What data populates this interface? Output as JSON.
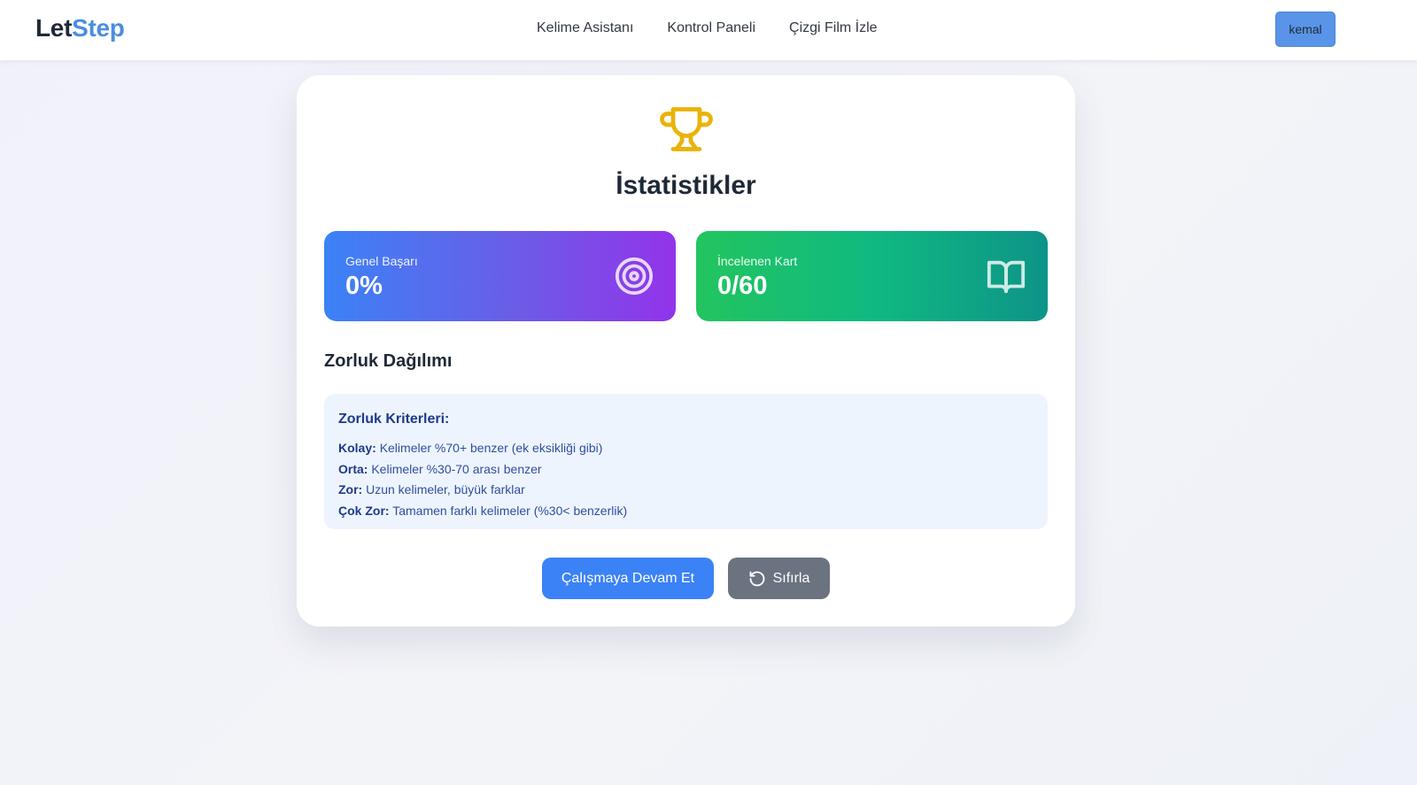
{
  "nav": {
    "logo_part1": "Let",
    "logo_part2": "Step",
    "links": [
      "Kelime Asistanı",
      "Kontrol Paneli",
      "Çizgi Film İzle"
    ],
    "user": "kemal"
  },
  "stats": {
    "title": "İstatistikler",
    "cards": [
      {
        "label": "Genel Başarı",
        "value": "0%",
        "icon": "target-icon"
      },
      {
        "label": "İncelenen Kart",
        "value": "0/60",
        "icon": "open-book-icon"
      }
    ]
  },
  "difficulty": {
    "section_title": "Zorluk Dağılımı",
    "criteria_title": "Zorluk Kriterleri:",
    "criteria": [
      {
        "level": "Kolay:",
        "desc": "Kelimeler %70+ benzer (ek eksikliği gibi)"
      },
      {
        "level": "Orta:",
        "desc": "Kelimeler %30-70 arası benzer"
      },
      {
        "level": "Zor:",
        "desc": "Uzun kelimeler, büyük farklar"
      },
      {
        "level": "Çok Zor:",
        "desc": "Tamamen farklı kelimeler (%30< benzerlik)"
      }
    ]
  },
  "buttons": {
    "continue": "Çalışmaya Devam Et",
    "reset": "Sıfırla"
  },
  "colors": {
    "accent": "#3b82f6",
    "trophy": "#eab308",
    "reset_button": "#6b7280"
  }
}
